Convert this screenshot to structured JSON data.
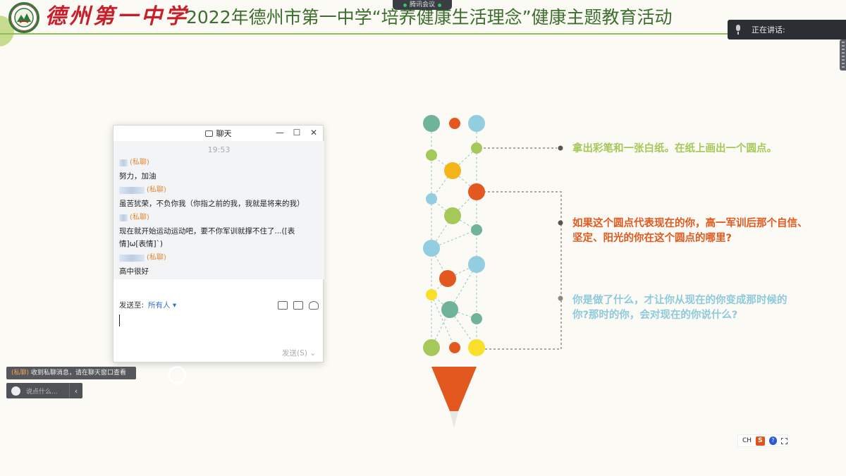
{
  "header": {
    "school_logo_text": "德州第一中学",
    "title": "2022年德州市第一中学“培养健康生活理念”健康主题教育活动"
  },
  "meeting_tab": {
    "label": "腾讯会议"
  },
  "speaking": {
    "label": "正在讲话:"
  },
  "chat": {
    "title": "聊天",
    "time": "19:53",
    "messages": [
      {
        "tag": "(私聊)",
        "text": "努力，加油"
      },
      {
        "tag": "(私聊)",
        "text": "虽苦犹荣，不负你我（你指之前的我，我就是将来的我）"
      },
      {
        "tag": "(私聊)",
        "text": "现在就开始运动运动吧，要不你军训就撑不住了...([表情]ω[表情]`)"
      },
      {
        "tag": "(私聊)",
        "text": "高中很好"
      }
    ],
    "send_to_label": "发送至:",
    "send_to_target": "所有人",
    "send_button": "发送(S)"
  },
  "notice": {
    "tag": "(私聊)",
    "text": "收到私聊消息，请在聊天窗口查看"
  },
  "say_box": {
    "placeholder": "说点什么..."
  },
  "diagram": {
    "statements": [
      "拿出彩笔和一张白纸。在纸上画出一个圆点。",
      "如果这个圆点代表现在的你，高一军训后那个自信、坚定、阳光的你在这个圆点的哪里?",
      "你是做了什么，才让你从现在的你变成那时候的你?那时的你，会对现在的你说什么?"
    ],
    "statement_colors": [
      "#a5c85a",
      "#e2581e",
      "#8ec9dc"
    ]
  },
  "ime": {
    "lang": "CH",
    "logo": "S",
    "help": "?"
  },
  "colors": {
    "green_title": "#3c6e2e",
    "red_logo": "#c8202a",
    "accent_orange": "#e2581e"
  }
}
